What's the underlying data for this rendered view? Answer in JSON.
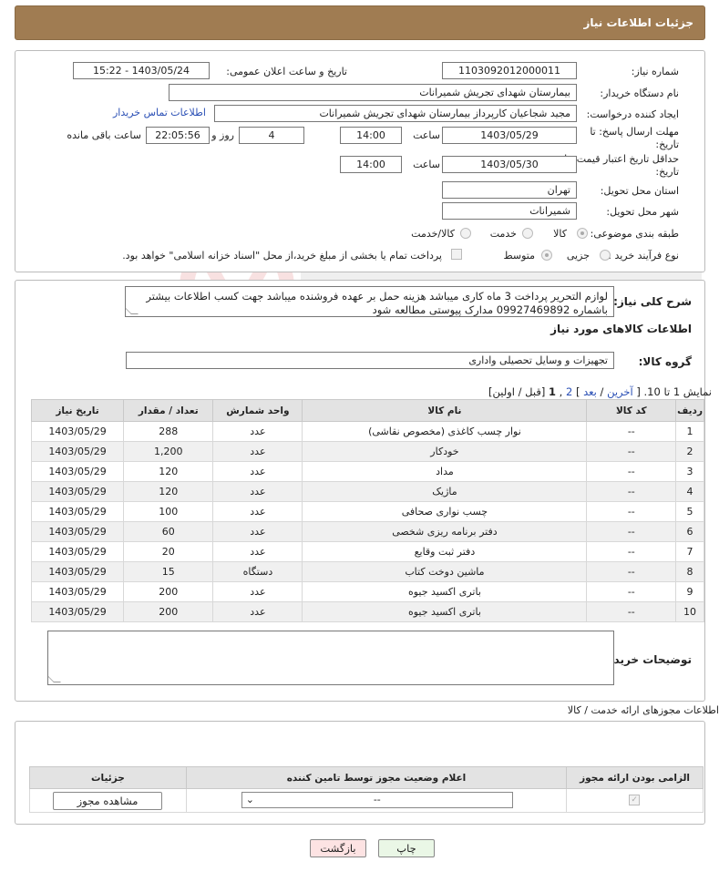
{
  "header": {
    "title": "جزئیات اطلاعات نیاز"
  },
  "form": {
    "need_number_label": "شماره نیاز:",
    "need_number": "1103092012000011",
    "announce_label": "تاریخ و ساعت اعلان عمومی:",
    "announce_value": "1403/05/24 - 15:22",
    "buyer_org_label": "نام دستگاه خریدار:",
    "buyer_org": "بیمارستان شهدای تجریش شمیرانات",
    "creator_label": "ایجاد کننده درخواست:",
    "creator": "مجید شجاعیان کارپرداز بیمارستان شهدای تجریش شمیرانات",
    "contact_link": "اطلاعات تماس خریدار",
    "deadline_label_1": "مهلت ارسال پاسخ: تا",
    "deadline_label_2": "تاریخ:",
    "deadline_date": "1403/05/29",
    "time_label": "ساعت",
    "deadline_time": "14:00",
    "days_value": "4",
    "days_label": "روز و",
    "remaining_time": "22:05:56",
    "remaining_label": "ساعت باقی مانده",
    "validity_label_1": "حداقل تاریخ اعتبار قیمت: تا",
    "validity_label_2": "تاریخ:",
    "validity_date": "1403/05/30",
    "validity_time": "14:00",
    "province_label": "استان محل تحویل:",
    "province": "تهران",
    "city_label": "شهر محل تحویل:",
    "city": "شمیرانات",
    "category_label": "طبقه بندی موضوعی:",
    "category_options": [
      "کالا",
      "خدمت",
      "کالا/خدمت"
    ],
    "process_label": "نوع فرآیند خرید :",
    "process_options": [
      "جزیی",
      "متوسط"
    ],
    "payment_note": "پرداخت تمام یا بخشی از مبلغ خرید،از محل \"اسناد خزانه اسلامی\" خواهد بود."
  },
  "description": {
    "label": "شرح کلی نیاز:",
    "text": "لوازم التحریر پرداخت 3 ماه کاری میباشد هزینه حمل بر عهده فروشنده میباشد جهت کسب اطلاعات بیشتر باشماره 09927469892 مدارک پیوستی مطالعه شود"
  },
  "goods": {
    "section_title": "اطلاعات کالاهای مورد نیاز",
    "group_label": "گروه کالا:",
    "group_value": "تجهیزات و وسایل تحصیلی واداری",
    "pager": {
      "showing": "نمایش 1 تا 10.",
      "open": "[",
      "last": "آخرین",
      "sep1": "/",
      "next": "بعد",
      "close": "]",
      "page2": "2",
      "page1": "1",
      "comma": ",",
      "prev_first": "[قبل / اولین]"
    },
    "columns": [
      "ردیف",
      "کد کالا",
      "نام کالا",
      "واحد شمارش",
      "تعداد / مقدار",
      "تاریخ نیاز"
    ],
    "rows": [
      [
        "1",
        "--",
        "نوار چسب کاغذی (مخصوص نقاشی)",
        "عدد",
        "288",
        "1403/05/29"
      ],
      [
        "2",
        "--",
        "خودکار",
        "عدد",
        "1,200",
        "1403/05/29"
      ],
      [
        "3",
        "--",
        "مداد",
        "عدد",
        "120",
        "1403/05/29"
      ],
      [
        "4",
        "--",
        "ماژیک",
        "عدد",
        "120",
        "1403/05/29"
      ],
      [
        "5",
        "--",
        "چسب نواری صحافی",
        "عدد",
        "100",
        "1403/05/29"
      ],
      [
        "6",
        "--",
        "دفتر برنامه ریزی شخصی",
        "عدد",
        "60",
        "1403/05/29"
      ],
      [
        "7",
        "--",
        "دفتر ثبت وقایع",
        "عدد",
        "20",
        "1403/05/29"
      ],
      [
        "8",
        "--",
        "ماشین دوخت کتاب",
        "دستگاه",
        "15",
        "1403/05/29"
      ],
      [
        "9",
        "--",
        "باتری اکسید جیوه",
        "عدد",
        "200",
        "1403/05/29"
      ],
      [
        "10",
        "--",
        "باتری اکسید جیوه",
        "عدد",
        "200",
        "1403/05/29"
      ]
    ]
  },
  "buyer_notes": {
    "label": "توضیحات خریدار:",
    "text": ""
  },
  "permits": {
    "section_title": "اطلاعات مجوزهای ارائه خدمت / کالا",
    "columns": [
      "الزامی بودن ارائه مجوز",
      "اعلام وضعیت مجوز توسط تامین کننده",
      "جزئیات"
    ],
    "select_value": "--",
    "view_button": "مشاهده مجوز"
  },
  "actions": {
    "print": "چاپ",
    "back": "بازگشت"
  },
  "colors": {
    "header": "#a07c52",
    "link": "#2a4fb5",
    "back_button": "#fde3e3",
    "print_button": "#eaf7e6"
  }
}
